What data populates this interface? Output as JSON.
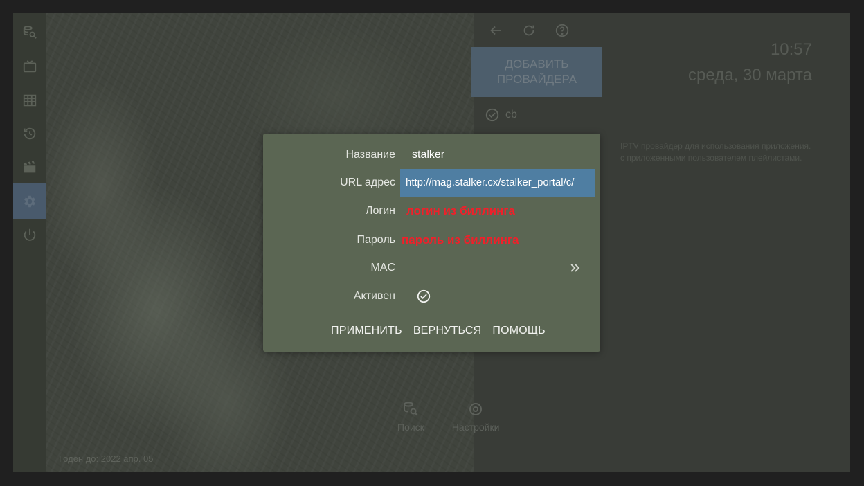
{
  "sidebar": {
    "items": [
      {
        "icon": "search-database-icon"
      },
      {
        "icon": "tv-icon"
      },
      {
        "icon": "grid-icon"
      },
      {
        "icon": "history-icon"
      },
      {
        "icon": "clapperboard-icon"
      },
      {
        "icon": "gear-icon",
        "active": true
      },
      {
        "icon": "power-icon"
      }
    ]
  },
  "right_panel": {
    "add_provider_label": "ДОБАВИТЬ\nПРОВАЙДЕРА",
    "clock_time": "10:57",
    "clock_date": "среда, 30 марта",
    "provider_name": "cb",
    "description_line1": "IPTV провайдер для использования приложения.",
    "description_line2": "с приложенными пользователем плейлистами."
  },
  "background": {
    "bottom_nav": [
      {
        "label": "Поиск",
        "icon": "search-database-icon"
      },
      {
        "label": "Настройки",
        "icon": "gear-icon"
      }
    ],
    "expiry_text": "Годен до: 2022 апр. 05"
  },
  "dialog": {
    "fields": {
      "name_label": "Название",
      "name_value": "stalker",
      "url_label": "URL адрес",
      "url_value": "http://mag.stalker.cx/stalker_portal/c/",
      "login_label": "Логин",
      "login_value": "логин из биллинга",
      "password_label": "Пароль",
      "password_value": "пароль из биллинга",
      "mac_label": "MAC",
      "active_label": "Активен"
    },
    "buttons": {
      "apply": "ПРИМЕНИТЬ",
      "back": "ВЕРНУТЬСЯ",
      "help": "ПОМОЩЬ"
    }
  },
  "colors": {
    "dialog_bg": "#5b6653",
    "url_field_bg": "#4f7ea2",
    "annotation_red": "#f0202a",
    "active_sidebar": "#495a6c"
  }
}
